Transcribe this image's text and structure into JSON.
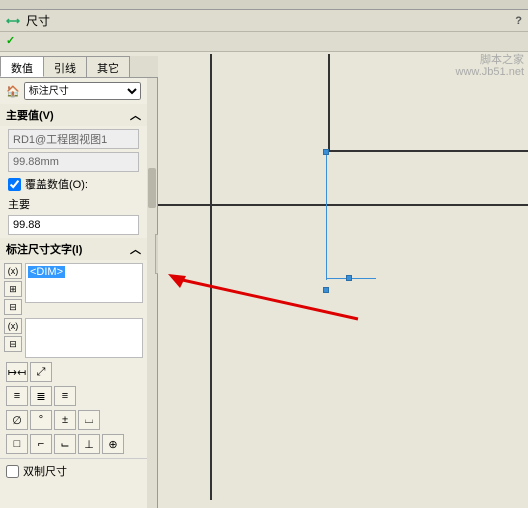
{
  "watermark": {
    "line1": "脚本之家",
    "line2": "www.Jb51.net"
  },
  "title": "尺寸",
  "ok_symbol": "✓",
  "help_symbol": "?",
  "tabs": [
    "数值",
    "引线",
    "其它"
  ],
  "trunc_select": "标注尺寸",
  "sections": {
    "primary": {
      "header": "主要值(V)",
      "name_field": "RD1@工程图视图1",
      "value_field": "99.88mm",
      "override_cb_label": "覆盖数值(O):",
      "override_checked": true,
      "sub_label": "主要",
      "override_value": "99.88"
    },
    "dimtext": {
      "header": "标注尺寸文字(I)",
      "text1_sel": "<DIM>",
      "text2": ""
    },
    "dual": {
      "cb_label": "双制尺寸",
      "checked": false
    }
  },
  "sidebtns": [
    "(x)",
    "⊞",
    "⊟"
  ],
  "sidebtns2": [
    "(x)",
    "⊟"
  ],
  "row1": [
    "↦↤",
    "⤢"
  ],
  "row2": [
    "≡",
    "≣",
    "≡"
  ],
  "row3": [
    "∅",
    "°",
    "±",
    "⌴"
  ],
  "row4": [
    "□",
    "⌐",
    "⌙",
    "⊥",
    "⊕"
  ]
}
